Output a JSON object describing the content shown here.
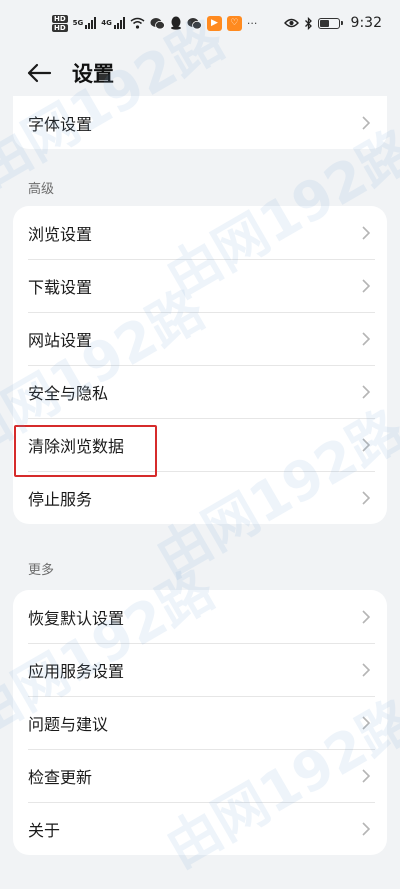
{
  "status_bar": {
    "hd1": "HD",
    "hd2": "HD",
    "net1": "5G",
    "net2": "4G",
    "more": "···",
    "time": "9:32",
    "battery_level": 0.55
  },
  "header": {
    "title": "设置"
  },
  "top_item": {
    "label": "字体设置"
  },
  "sections": {
    "advanced": {
      "title": "高级",
      "items": [
        "浏览设置",
        "下载设置",
        "网站设置",
        "安全与隐私",
        "清除浏览数据",
        "停止服务"
      ]
    },
    "more": {
      "title": "更多",
      "items": [
        "恢复默认设置",
        "应用服务设置",
        "问题与建议",
        "检查更新",
        "关于"
      ]
    }
  },
  "watermark": {
    "text": "由网192路"
  },
  "colors": {
    "background": "#f1f3f5",
    "card": "#ffffff",
    "highlight": "#d62b2b",
    "watermark": "#78aadc"
  }
}
